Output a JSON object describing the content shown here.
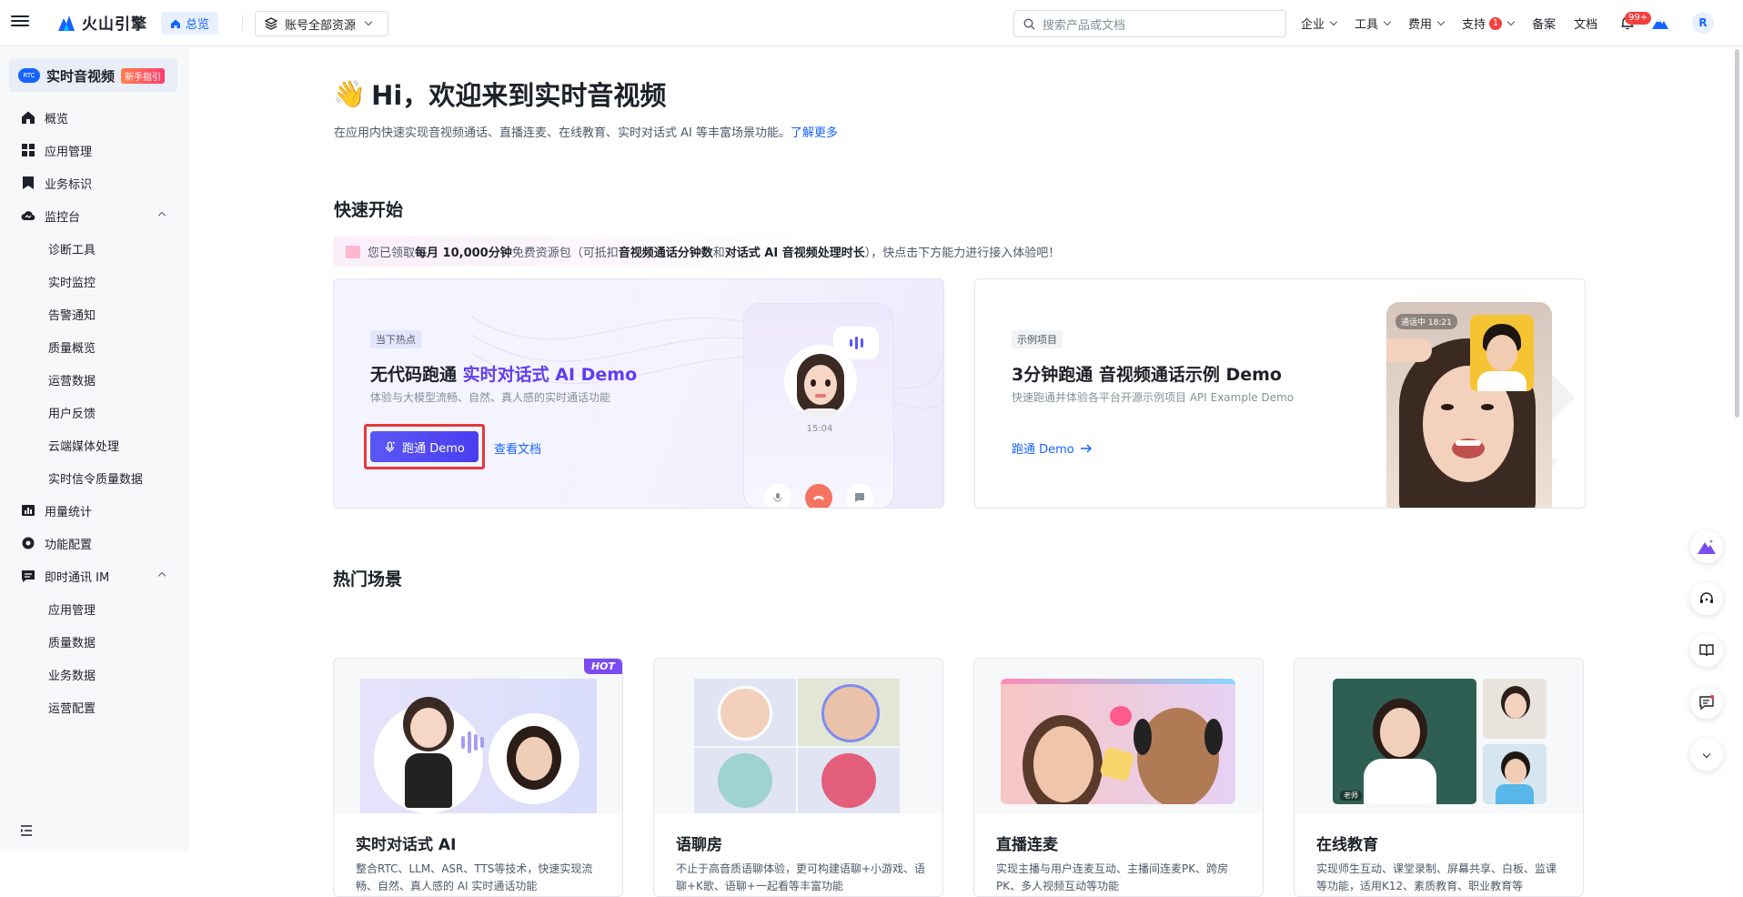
{
  "header": {
    "logo_text": "火山引擎",
    "home_label": "总览",
    "resource_selector": "账号全部资源",
    "search_placeholder": "搜索产品或文档",
    "nav": [
      {
        "label": "企业"
      },
      {
        "label": "工具"
      },
      {
        "label": "费用"
      },
      {
        "label": "支持",
        "badge": "1"
      },
      {
        "label": "备案"
      },
      {
        "label": "文档"
      }
    ],
    "bell_badge": "99+",
    "avatar_initial": "R"
  },
  "sidebar": {
    "product_icon_text": "RTC",
    "product_name": "实时音视频",
    "new_tag": "新手指引",
    "items": [
      {
        "label": "概览",
        "icon": "home-icon"
      },
      {
        "label": "应用管理",
        "icon": "apps-grid-icon"
      },
      {
        "label": "业务标识",
        "icon": "bookmark-icon"
      },
      {
        "label": "监控台",
        "icon": "cloud-monitor-icon",
        "expanded": true
      },
      {
        "label": "诊断工具",
        "sub": true
      },
      {
        "label": "实时监控",
        "sub": true
      },
      {
        "label": "告警通知",
        "sub": true
      },
      {
        "label": "质量概览",
        "sub": true
      },
      {
        "label": "运营数据",
        "sub": true
      },
      {
        "label": "用户反馈",
        "sub": true
      },
      {
        "label": "云端媒体处理",
        "sub": true
      },
      {
        "label": "实时信令质量数据",
        "sub": true
      },
      {
        "label": "用量统计",
        "icon": "bar-chart-icon"
      },
      {
        "label": "功能配置",
        "icon": "gear-icon"
      },
      {
        "label": "即时通讯 IM",
        "icon": "chat-icon",
        "expanded": true
      },
      {
        "label": "应用管理",
        "sub": true
      },
      {
        "label": "质量数据",
        "sub": true
      },
      {
        "label": "业务数据",
        "sub": true
      },
      {
        "label": "运营配置",
        "sub": true
      }
    ]
  },
  "main": {
    "welcome_emoji": "👋",
    "welcome_title": "Hi，欢迎来到实时音视频",
    "description": "在应用内快速实现音视频通话、直播连麦、在线教育、实时对话式 AI 等丰富场景功能。",
    "learn_more": "了解更多",
    "quick_start_title": "快速开始",
    "notice": {
      "p1": "您已领取",
      "b1": "每月 10,000分钟",
      "p2": "免费资源包（可抵扣",
      "b2": "音视频通话分钟数",
      "p3": "和",
      "b3": "对话式 AI 音视频处理时长",
      "p4": "），快点击下方能力进行接入体验吧！"
    },
    "card_ai": {
      "tag": "当下热点",
      "title_plain": "无代码跑通 ",
      "title_highlight": "实时对话式 AI Demo",
      "subtitle": "体验与大模型流畅、自然、真人感的实时通话功能",
      "primary_button": "跑通 Demo",
      "doc_link": "查看文档",
      "phone_time": "15:04"
    },
    "card_example": {
      "tag": "示例项目",
      "title": "3分钟跑通 音视频通话示例 Demo",
      "subtitle": "快速跑通并体验各平台开源示例项目 API Example Demo",
      "link": "跑通 Demo",
      "calling_label": "通话中 18:21"
    },
    "hot_scenes_title": "热门场景",
    "scenes": [
      {
        "title": "实时对话式 AI",
        "desc": "整合RTC、LLM、ASR、TTS等技术，快速实现流畅、自然、真人感的 AI 实时通话功能",
        "badge": "HOT"
      },
      {
        "title": "语聊房",
        "desc": "不止于高音质语聊体验，更可构建语聊+小游戏、语聊+K歌、语聊+一起看等丰富功能"
      },
      {
        "title": "直播连麦",
        "desc": "实现主播与用户连麦互动、主播间连麦PK、跨房PK、多人视频互动等功能"
      },
      {
        "title": "在线教育",
        "desc": "实现师生互动、课堂录制、屏幕共享、白板、监课等功能，适用K12、素质教育、职业教育等"
      }
    ],
    "teacher_label": "老师"
  },
  "colors": {
    "brand": "#1664ff",
    "ai_purple": "#5e3df0",
    "highlight_red": "#e5383b"
  }
}
